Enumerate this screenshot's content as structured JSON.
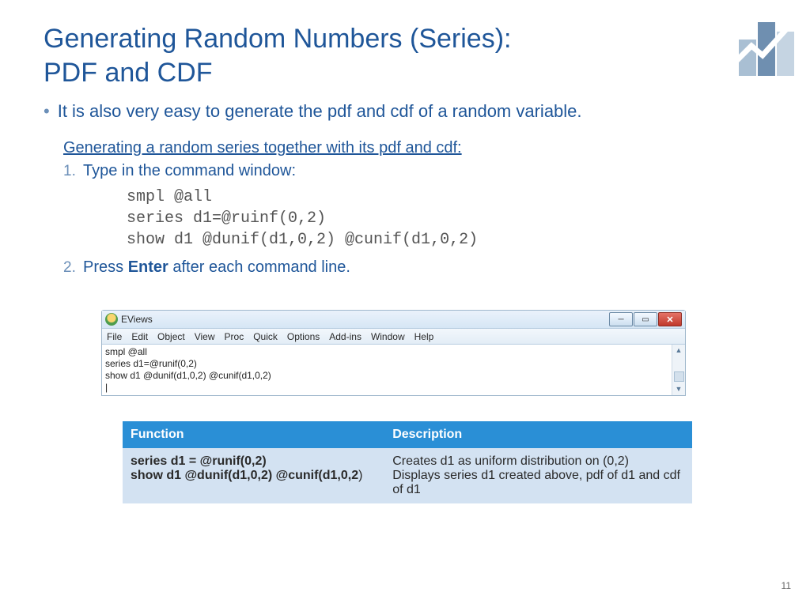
{
  "title_line1": "Generating Random Numbers (Series):",
  "title_line2": "PDF and CDF",
  "bullet": "It is also very easy to generate the pdf and cdf of a random variable.",
  "subheading": "Generating a random series together with its pdf and cdf:",
  "steps": {
    "one_marker": "1.",
    "one_text": "Type in the command window:",
    "two_marker": "2.",
    "two_pre": "Press ",
    "two_bold": "Enter",
    "two_post": " after each command line."
  },
  "code": "smpl @all\nseries d1=@ruinf(0,2)\nshow d1 @dunif(d1,0,2) @cunif(d1,0,2)",
  "eviews": {
    "title": "EViews",
    "menu": [
      "File",
      "Edit",
      "Object",
      "View",
      "Proc",
      "Quick",
      "Options",
      "Add-ins",
      "Window",
      "Help"
    ],
    "cmd": "smpl @all\nseries d1=@runif(0,2)\nshow d1 @dunif(d1,0,2) @cunif(d1,0,2)\n|"
  },
  "table": {
    "h1": "Function",
    "h2": "Description",
    "fn_line1": "series d1 = @runif(0,2)",
    "fn_line2a": "show d1 @dunif(d1,0,2) @cunif(d1,0,2",
    "fn_line2b": ")",
    "desc_line1": "Creates d1 as uniform distribution on (0,2)",
    "desc_line2": "Displays series d1 created above, pdf of d1 and cdf of d1"
  },
  "page_num": "11"
}
